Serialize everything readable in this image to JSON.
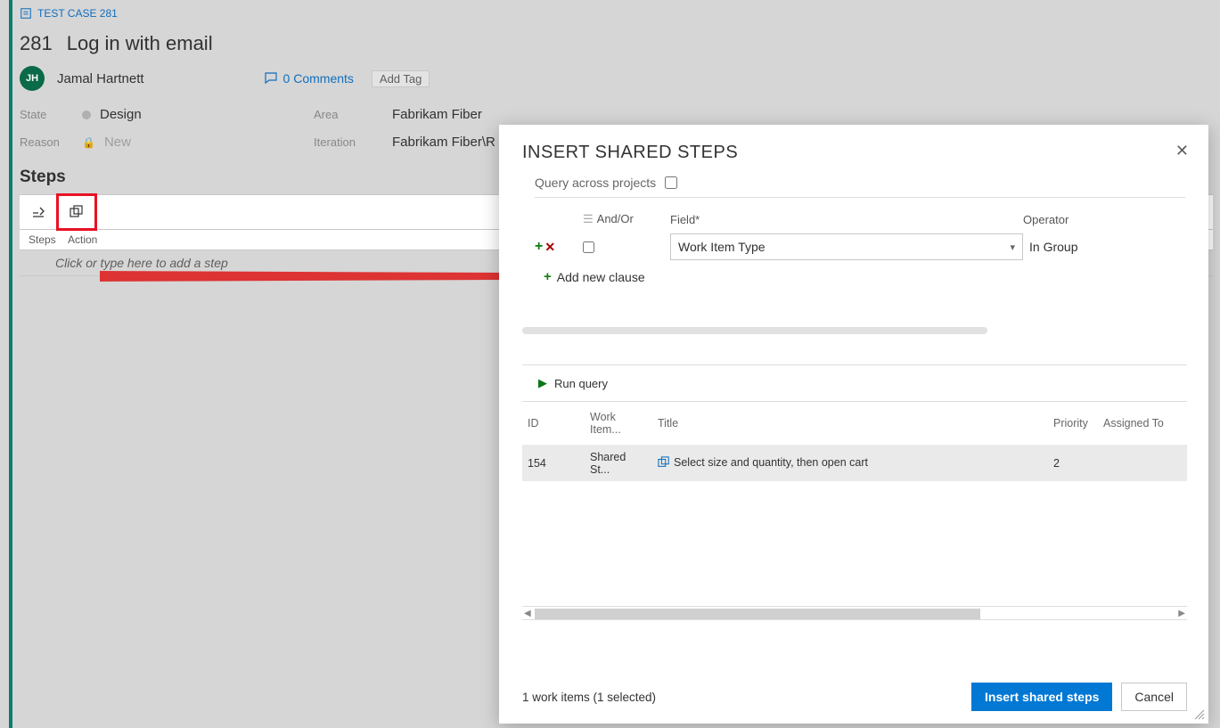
{
  "breadcrumb": {
    "type_label": "TEST CASE 281"
  },
  "work_item": {
    "id": "281",
    "title": "Log in with email",
    "owner": {
      "initials": "JH",
      "name": "Jamal Hartnett"
    },
    "comments_label": "0 Comments",
    "add_tag_label": "Add Tag",
    "fields": {
      "state_label": "State",
      "state_value": "Design",
      "reason_label": "Reason",
      "reason_value": "New",
      "area_label": "Area",
      "area_value": "Fabrikam Fiber",
      "iteration_label": "Iteration",
      "iteration_value": "Fabrikam Fiber\\R"
    }
  },
  "steps": {
    "heading": "Steps",
    "cols": {
      "c1": "Steps",
      "c2": "Action"
    },
    "placeholder": "Click or type here to add a step"
  },
  "dialog": {
    "title": "INSERT SHARED STEPS",
    "query_across_label": "Query across projects",
    "query_across_checked": false,
    "headers": {
      "andor": "And/Or",
      "field": "Field*",
      "operator": "Operator"
    },
    "clause": {
      "checked": false,
      "field": "Work Item Type",
      "operator": "In Group"
    },
    "add_clause_label": "Add new clause",
    "run_label": "Run query",
    "results": {
      "cols": {
        "id": "ID",
        "type": "Work Item...",
        "title": "Title",
        "priority": "Priority",
        "assigned": "Assigned To"
      },
      "rows": [
        {
          "id": "154",
          "type": "Shared St...",
          "title": "Select size and quantity, then open cart",
          "priority": "2",
          "assigned": ""
        }
      ]
    },
    "footer_status": "1 work items (1 selected)",
    "insert_btn": "Insert shared steps",
    "cancel_btn": "Cancel"
  }
}
